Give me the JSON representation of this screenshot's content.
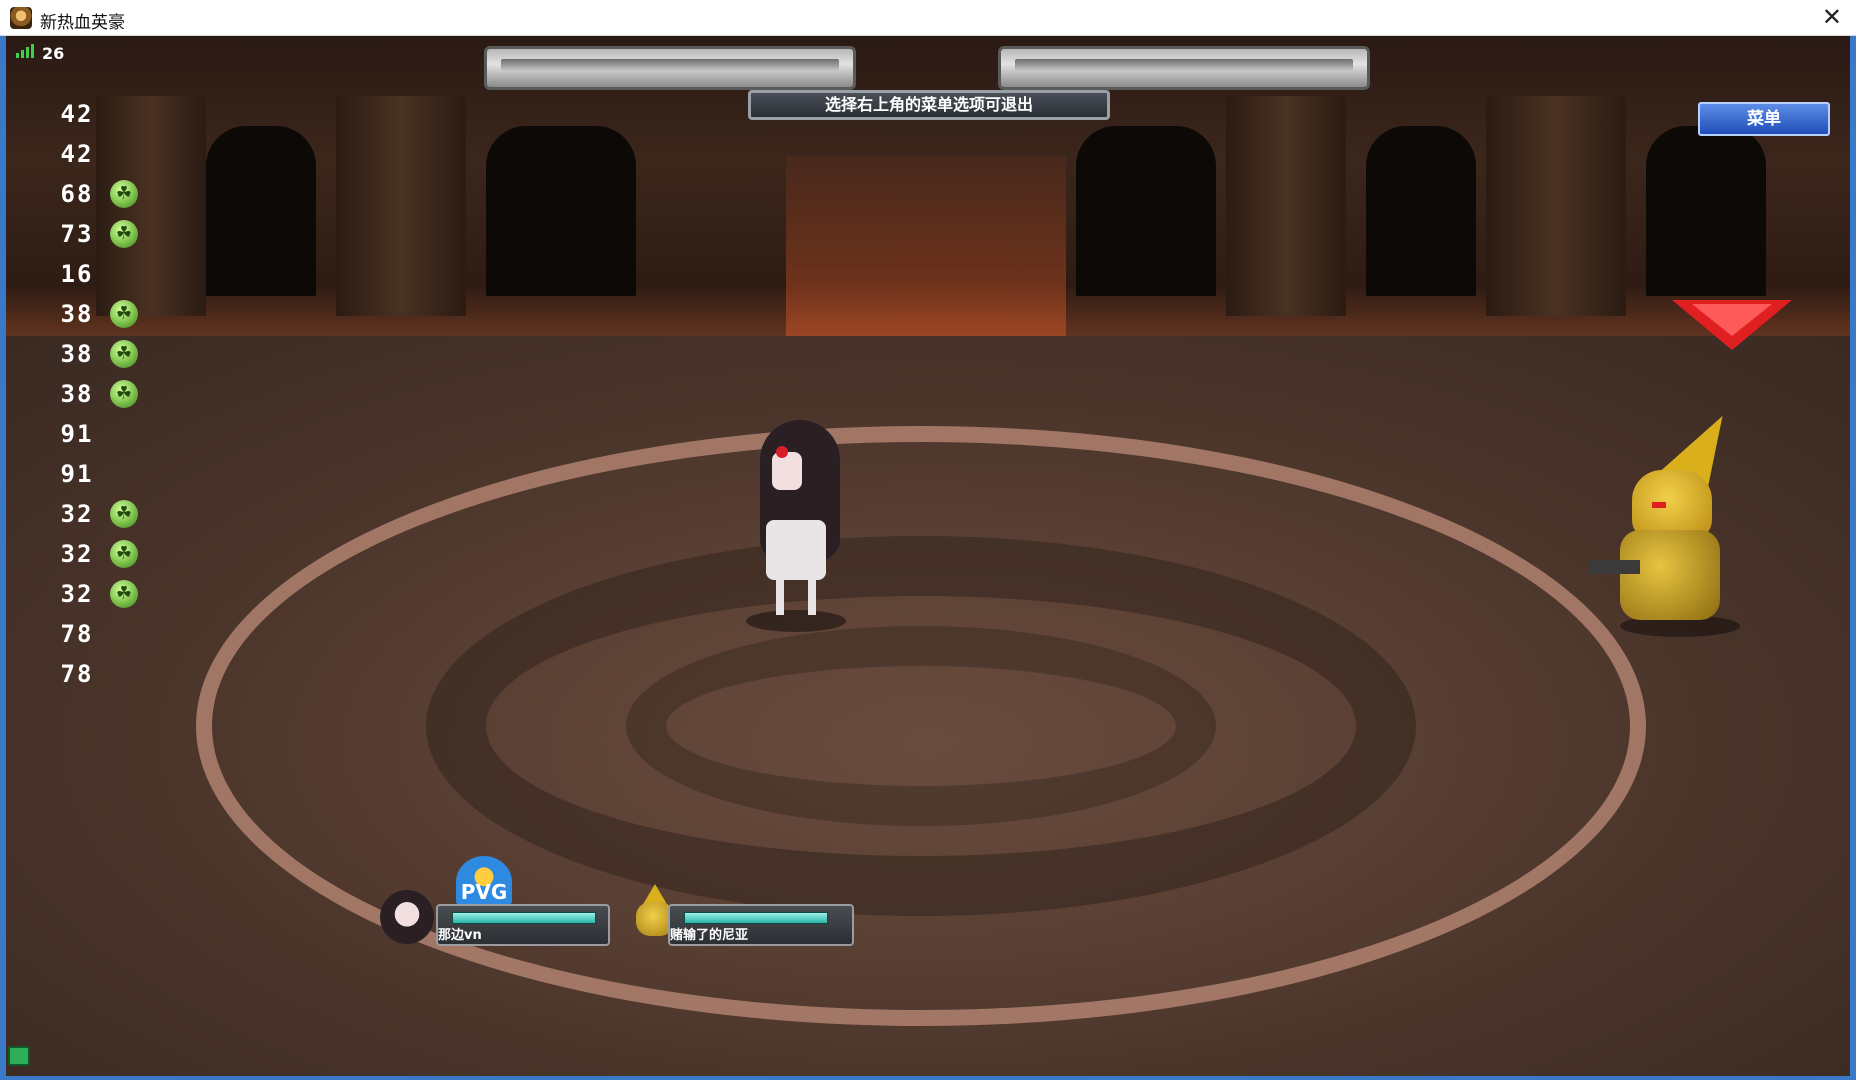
{
  "window": {
    "title": "新热血英豪",
    "close_glyph": "✕"
  },
  "hud": {
    "fps": "26",
    "notice": "选择右上角的菜单选项可退出",
    "menu_label": "菜单"
  },
  "cooldowns": [
    {
      "value": "42",
      "ready": false
    },
    {
      "value": "42",
      "ready": false
    },
    {
      "value": "68",
      "ready": true
    },
    {
      "value": "73",
      "ready": true
    },
    {
      "value": "16",
      "ready": false
    },
    {
      "value": "38",
      "ready": true
    },
    {
      "value": "38",
      "ready": true
    },
    {
      "value": "38",
      "ready": true
    },
    {
      "value": "91",
      "ready": false
    },
    {
      "value": "91",
      "ready": false
    },
    {
      "value": "32",
      "ready": true
    },
    {
      "value": "32",
      "ready": true
    },
    {
      "value": "32",
      "ready": true
    },
    {
      "value": "78",
      "ready": false
    },
    {
      "value": "78",
      "ready": false
    }
  ],
  "units": {
    "player": {
      "name": "那边vn",
      "hp": 0.97,
      "badge": "PVG"
    },
    "enemy": {
      "name": "赌输了的尼亚",
      "hp": 0.9
    }
  },
  "colors": {
    "menu_button": "#1f4fb8",
    "marker": "#e02020",
    "hp_fill": "#29b4a6",
    "signal": "#3fd04a"
  },
  "icons": [
    "signal-icon",
    "leaf-ready-icon",
    "enemy-marker-icon",
    "tray-icon"
  ]
}
